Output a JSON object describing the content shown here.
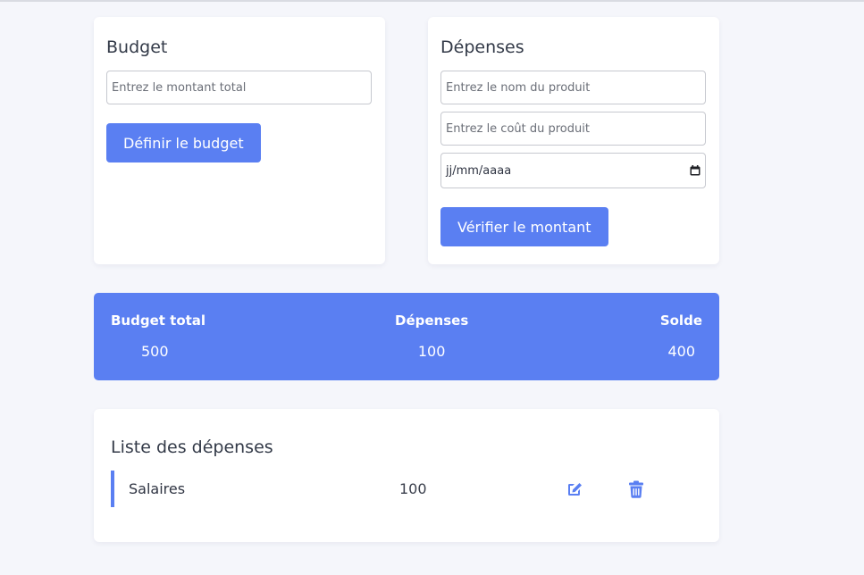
{
  "budget_card": {
    "title": "Budget",
    "amount_placeholder": "Entrez le montant total",
    "submit_label": "Définir le budget"
  },
  "expenses_card": {
    "title": "Dépenses",
    "name_placeholder": "Entrez le nom du produit",
    "cost_placeholder": "Entrez le coût du produit",
    "date_placeholder": "jj/mm/aaaa",
    "submit_label": "Vérifier le montant"
  },
  "summary": {
    "total_label": "Budget total",
    "total_value": "500",
    "expenses_label": "Dépenses",
    "expenses_value": "100",
    "balance_label": "Solde",
    "balance_value": "400"
  },
  "expense_list": {
    "title": "Liste des dépenses",
    "items": [
      {
        "name": "Salaires",
        "amount": "100"
      }
    ]
  },
  "icons": {
    "edit": "edit-icon",
    "delete": "trash-icon",
    "calendar": "calendar-icon"
  },
  "colors": {
    "accent": "#5a7ff2",
    "background": "#f5f6fb",
    "card": "#ffffff"
  }
}
